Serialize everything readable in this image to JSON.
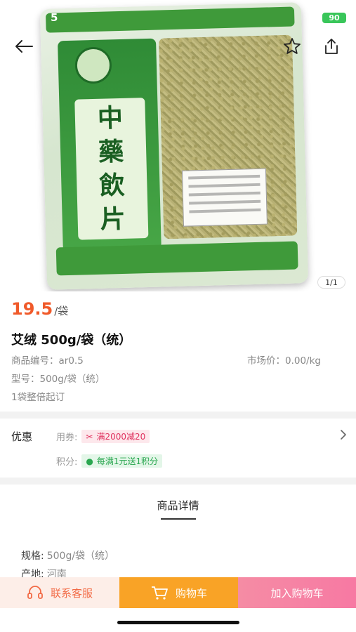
{
  "status_bar": {
    "time": "5",
    "battery": "90"
  },
  "gallery": {
    "indicator": "1/1",
    "package_text": [
      "中",
      "藥",
      "飲",
      "片"
    ]
  },
  "product": {
    "price": "19.5",
    "price_unit": "/袋",
    "title": "艾绒 500g/袋（统）",
    "code_label": "商品编号：",
    "code_value": "ar0.5",
    "market_label": "市场价：",
    "market_value": "0.00/kg",
    "model_label": "型号：",
    "model_value": "500g/袋（统）",
    "moq": "1袋整倍起订"
  },
  "discounts": {
    "title": "优惠",
    "coupon_label": "用券:",
    "coupon_tag": "满2000减20",
    "points_label": "积分:",
    "points_tag": "每满1元送1积分"
  },
  "details": {
    "title": "商品详情",
    "spec_label": "规格:",
    "spec_value": "500g/袋（统）",
    "origin_label": "产地:",
    "origin_value": "河南"
  },
  "bottom_bar": {
    "service_label": "联系客服",
    "cart_label": "购物车",
    "add_label": "加入购物车"
  },
  "colors": {
    "price": "#f05a2a",
    "cart": "#f9a326",
    "add_to_cart": "#f779a3",
    "service": "#f26a45"
  }
}
